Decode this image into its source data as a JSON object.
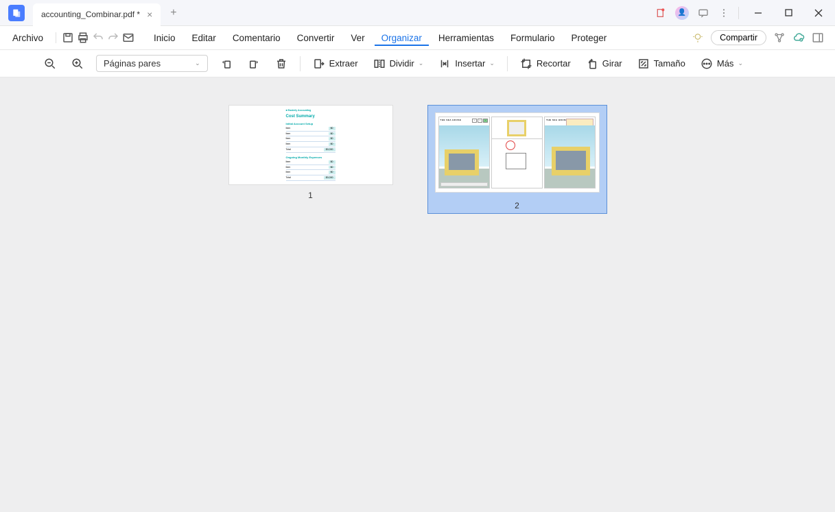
{
  "tab": {
    "title": "accounting_Combinar.pdf *"
  },
  "file_menu": "Archivo",
  "menu": {
    "inicio": "Inicio",
    "editar": "Editar",
    "comentario": "Comentario",
    "convertir": "Convertir",
    "ver": "Ver",
    "organizar": "Organizar",
    "herramientas": "Herramientas",
    "formulario": "Formulario",
    "proteger": "Proteger"
  },
  "share": "Compartir",
  "toolbar": {
    "pages_selector": "Páginas pares",
    "extraer": "Extraer",
    "dividir": "Dividir",
    "insertar": "Insertar",
    "recortar": "Recortar",
    "girar": "Girar",
    "tamano": "Tamaño",
    "mas": "Más"
  },
  "pages": {
    "p1": "1",
    "p2": "2"
  },
  "p1content": {
    "brand": "■ Easterly Accounting",
    "title": "Cost Summary",
    "s1": "Initial Account Setup",
    "s2": "Ongoing Monthly Expenses"
  },
  "p2content": {
    "title": "THE SEA HOUSE"
  }
}
